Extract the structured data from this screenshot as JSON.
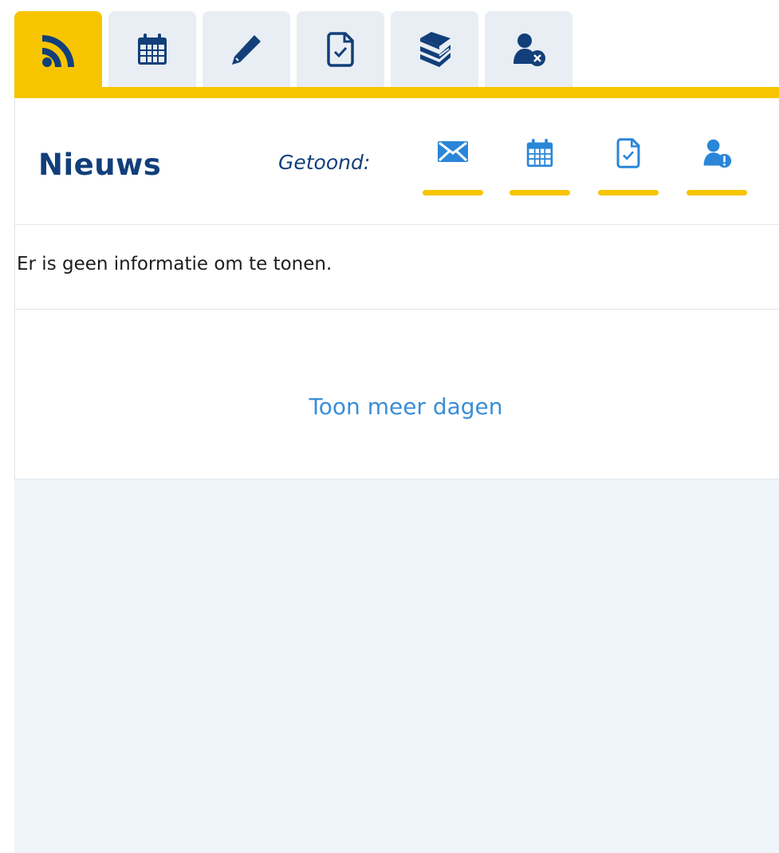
{
  "colors": {
    "accent": "#f7c500",
    "primary": "#123f7a",
    "link": "#3a8ed8",
    "tab_bg": "#e8eef3",
    "page_bg": "#f0f5f9"
  },
  "tabs": [
    {
      "icon": "rss-feed-icon",
      "active": true
    },
    {
      "icon": "calendar-icon",
      "active": false
    },
    {
      "icon": "pencil-icon",
      "active": false
    },
    {
      "icon": "document-check-icon",
      "active": false
    },
    {
      "icon": "books-icon",
      "active": false
    },
    {
      "icon": "user-remove-icon",
      "active": false
    }
  ],
  "panel": {
    "title": "Nieuws",
    "shown_label": "Getoond:",
    "filters": [
      {
        "icon": "envelope-icon"
      },
      {
        "icon": "calendar-icon"
      },
      {
        "icon": "document-check-icon"
      },
      {
        "icon": "user-alert-icon"
      }
    ],
    "empty_message": "Er is geen informatie om te tonen.",
    "more_link": "Toon meer dagen"
  }
}
